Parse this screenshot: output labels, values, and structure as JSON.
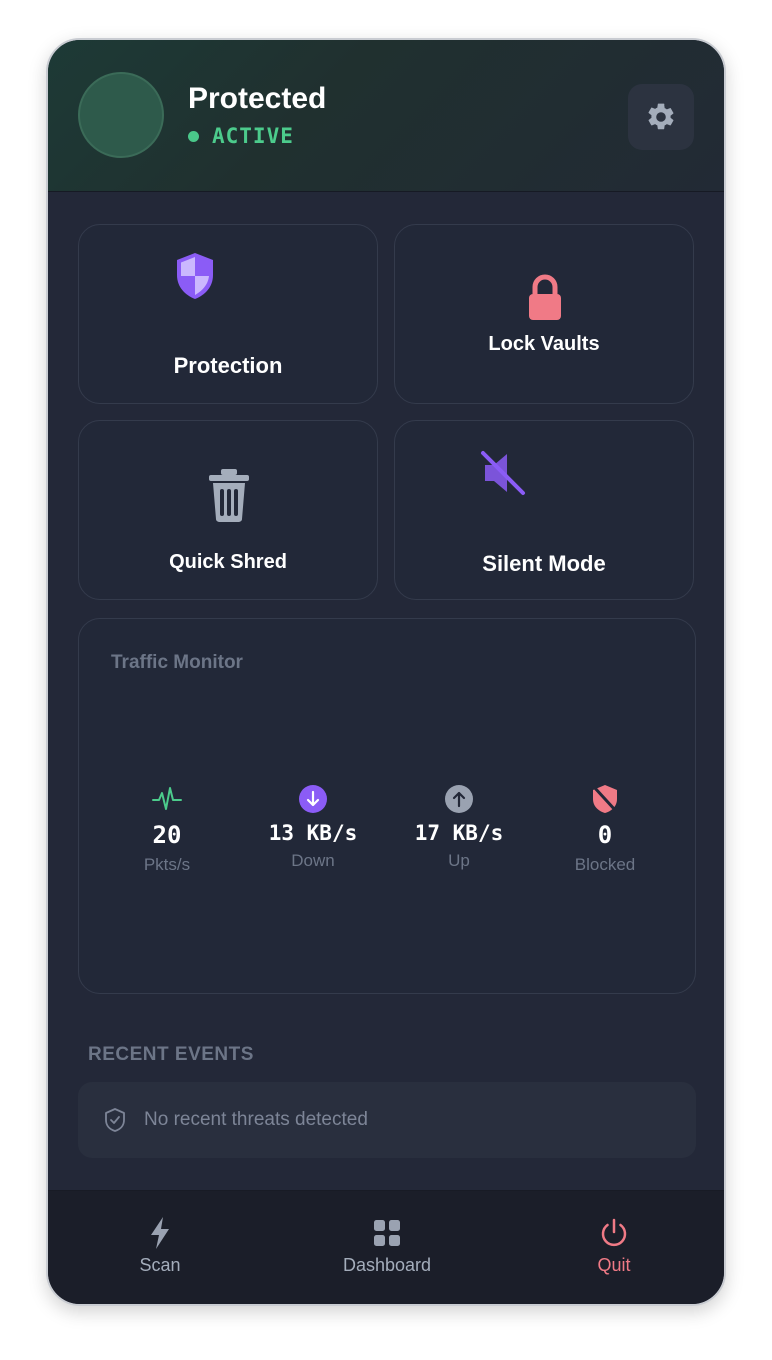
{
  "header": {
    "title": "Protected",
    "status": "ACTIVE",
    "status_color": "#4ccb8c"
  },
  "tiles": [
    {
      "label": "Protection",
      "icon": "shield-icon",
      "color": "#8b5cf6"
    },
    {
      "label": "Lock Vaults",
      "icon": "lock-icon",
      "color": "#f07a86"
    },
    {
      "label": "Quick Shred",
      "icon": "trash-icon",
      "color": "#a4adbb"
    },
    {
      "label": "Silent Mode",
      "icon": "mute-icon",
      "color": "#8b5cf6"
    }
  ],
  "traffic": {
    "title": "Traffic Monitor",
    "stats": [
      {
        "value": "20",
        "caption": "Pkts/s",
        "icon": "activity-icon"
      },
      {
        "value": "13 KB/s",
        "caption": "Down",
        "icon": "download-icon"
      },
      {
        "value": "17 KB/s",
        "caption": "Up",
        "icon": "upload-icon"
      },
      {
        "value": "0",
        "caption": "Blocked",
        "icon": "shield-off-icon"
      }
    ]
  },
  "events": {
    "title": "RECENT EVENTS",
    "empty_text": "No recent threats detected"
  },
  "nav": [
    {
      "label": "Scan",
      "icon": "bolt-icon"
    },
    {
      "label": "Dashboard",
      "icon": "grid-icon"
    },
    {
      "label": "Quit",
      "icon": "power-icon",
      "color": "#f07a86"
    }
  ]
}
